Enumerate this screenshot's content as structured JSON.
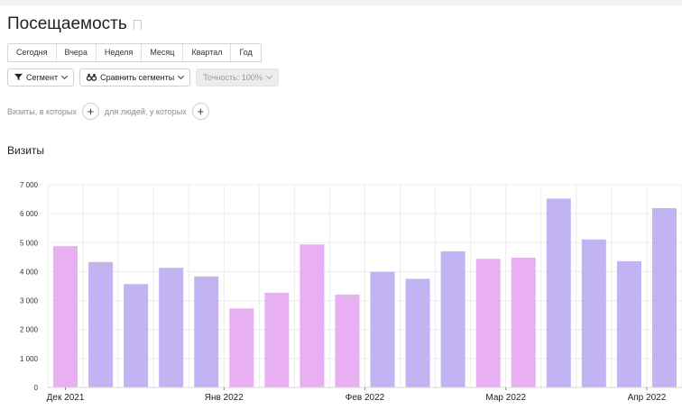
{
  "report": {
    "title": "Посещаемость",
    "periods": [
      "Сегодня",
      "Вчера",
      "Неделя",
      "Месяц",
      "Квартал",
      "Год"
    ],
    "segment_label": "Сегмент",
    "compare_label": "Сравнить сегменты",
    "accuracy_label": "Точность: 100%",
    "visits_condition": "Визиты, в которых",
    "people_condition": "для людей, у которых",
    "section_title": "Визиты"
  },
  "colors": {
    "pink": "#e8b0f3",
    "purple": "#c2b3f3"
  },
  "chart_data": {
    "type": "bar",
    "title": "Визиты",
    "ylim": [
      0,
      7000
    ],
    "yticks": [
      0,
      1000,
      2000,
      3000,
      4000,
      5000,
      6000,
      7000
    ],
    "ytick_labels": [
      "0",
      "1 000",
      "2 000",
      "3 000",
      "4 000",
      "5 000",
      "6 000",
      "7 000"
    ],
    "xtick_labels": [
      {
        "label": "Дек 2021",
        "at": 0
      },
      {
        "label": "Янв 2022",
        "at": 4.5
      },
      {
        "label": "Фев 2022",
        "at": 8.5
      },
      {
        "label": "Мар 2022",
        "at": 12.5
      },
      {
        "label": "Апр 2022",
        "at": 16.5
      }
    ],
    "grid": true,
    "values": [
      4880,
      4330,
      3570,
      4130,
      3830,
      2730,
      3270,
      4940,
      3210,
      3990,
      3750,
      4700,
      4440,
      4480,
      6520,
      5110,
      4360,
      6190
    ],
    "bar_colors": [
      "pink",
      "purple",
      "purple",
      "purple",
      "purple",
      "pink",
      "pink",
      "pink",
      "pink",
      "purple",
      "purple",
      "purple",
      "pink",
      "pink",
      "purple",
      "purple",
      "purple",
      "purple"
    ]
  }
}
